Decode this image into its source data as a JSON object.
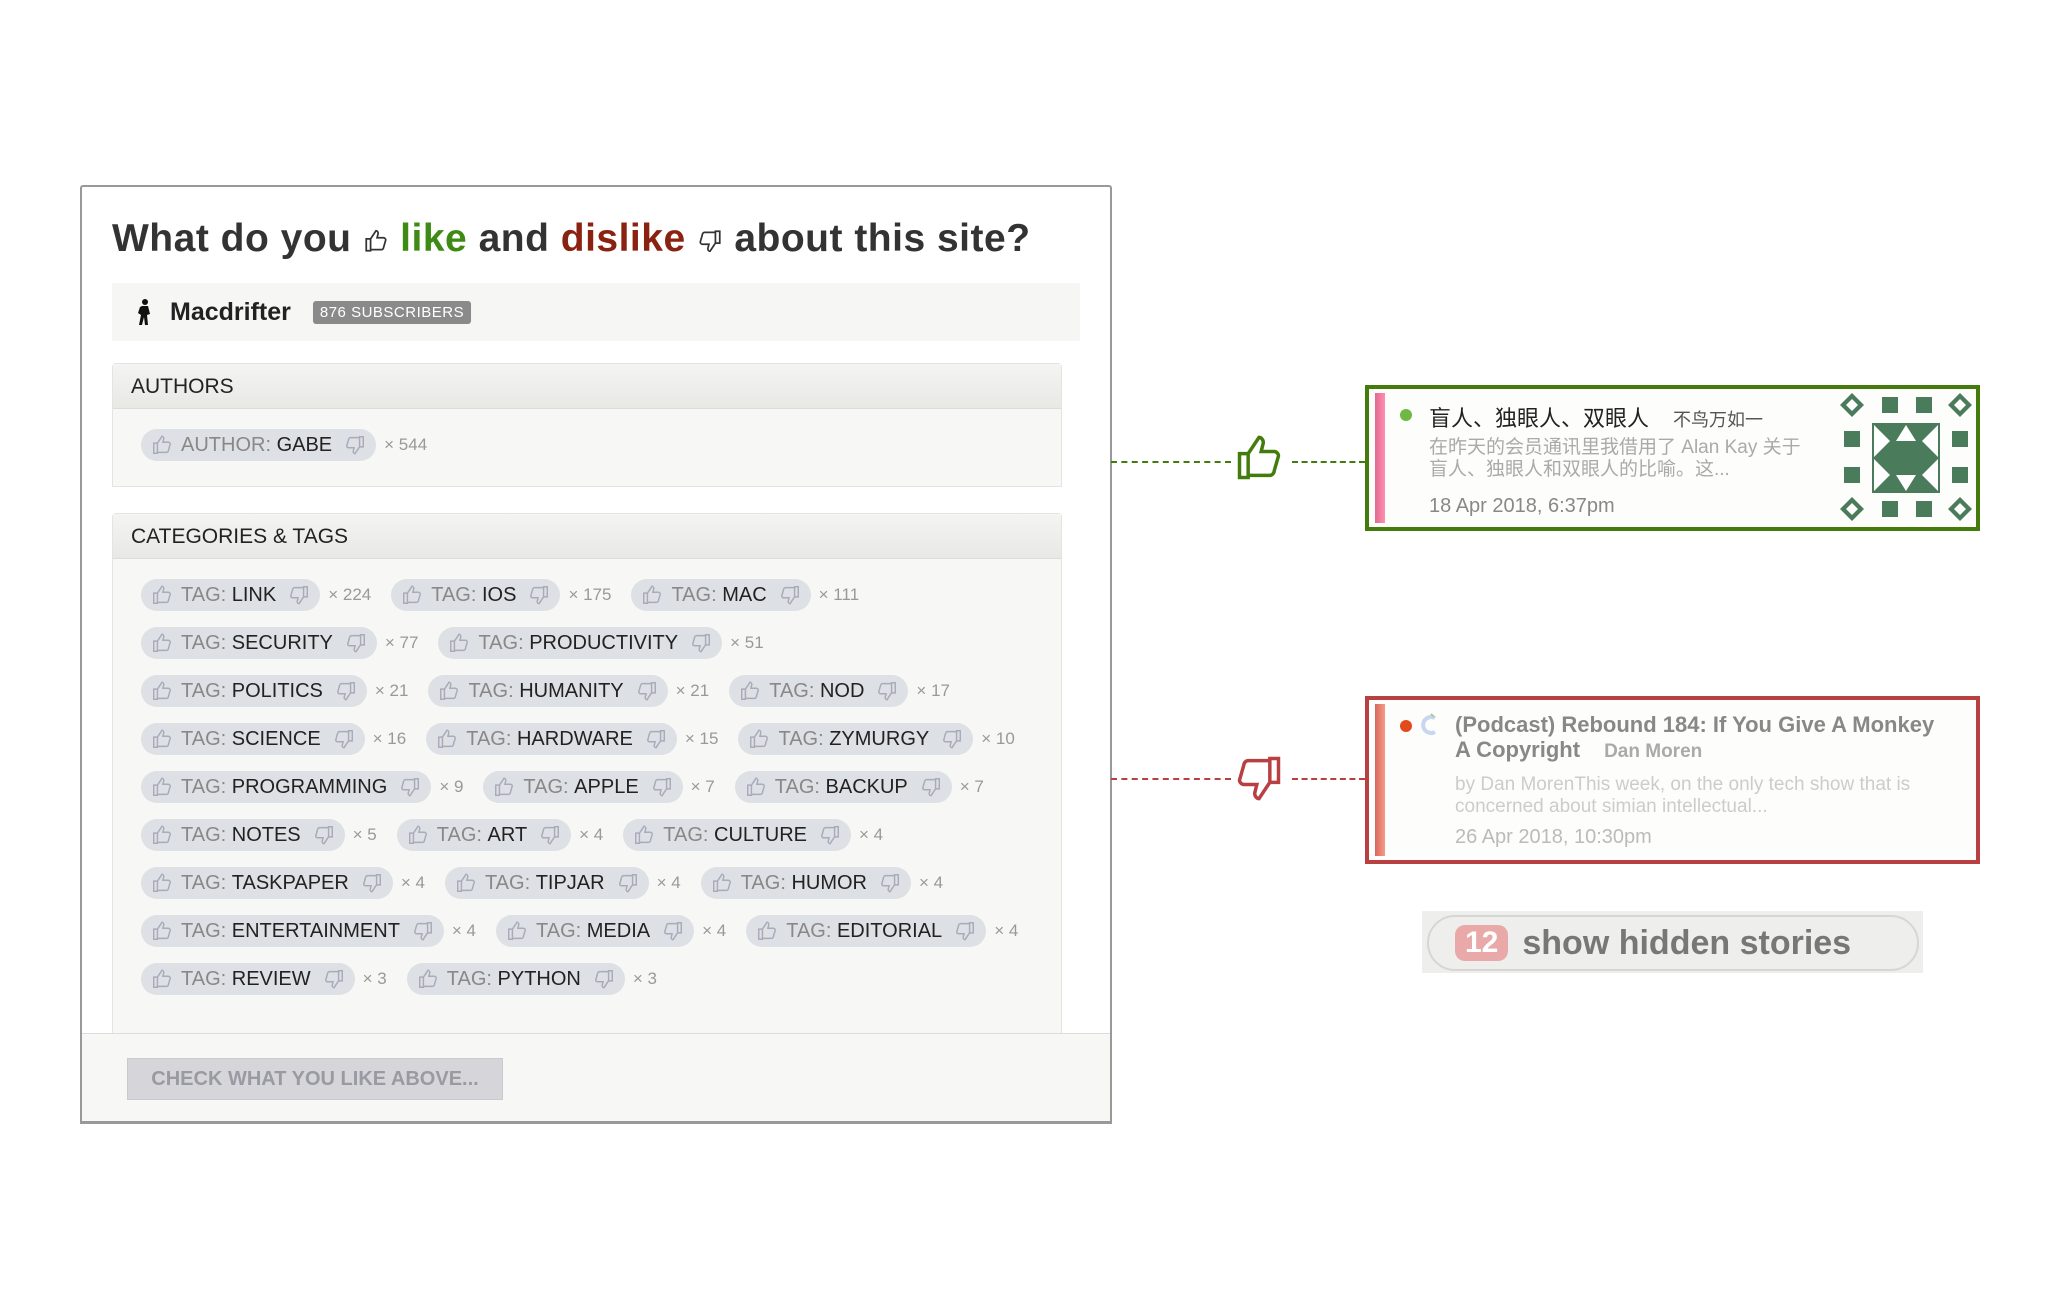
{
  "dialog": {
    "title": {
      "part1": "What do you",
      "like": "like",
      "part2": "and",
      "dislike": "dislike",
      "part3": "about this site?"
    },
    "feed": {
      "name": "Macdrifter",
      "subscribers": "876 SUBSCRIBERS"
    },
    "authors": {
      "header": "AUTHORS",
      "items": [
        {
          "prefix": "AUTHOR:",
          "name": "GABE",
          "count": "× 544"
        }
      ]
    },
    "categories": {
      "header": "CATEGORIES & TAGS",
      "items": [
        {
          "prefix": "TAG:",
          "name": "LINK",
          "count": "× 224"
        },
        {
          "prefix": "TAG:",
          "name": "IOS",
          "count": "× 175"
        },
        {
          "prefix": "TAG:",
          "name": "MAC",
          "count": "× 111"
        },
        {
          "prefix": "TAG:",
          "name": "SECURITY",
          "count": "× 77"
        },
        {
          "prefix": "TAG:",
          "name": "PRODUCTIVITY",
          "count": "× 51"
        },
        {
          "prefix": "TAG:",
          "name": "POLITICS",
          "count": "× 21"
        },
        {
          "prefix": "TAG:",
          "name": "HUMANITY",
          "count": "× 21"
        },
        {
          "prefix": "TAG:",
          "name": "NOD",
          "count": "× 17"
        },
        {
          "prefix": "TAG:",
          "name": "SCIENCE",
          "count": "× 16"
        },
        {
          "prefix": "TAG:",
          "name": "HARDWARE",
          "count": "× 15"
        },
        {
          "prefix": "TAG:",
          "name": "ZYMURGY",
          "count": "× 10"
        },
        {
          "prefix": "TAG:",
          "name": "PROGRAMMING",
          "count": "× 9"
        },
        {
          "prefix": "TAG:",
          "name": "APPLE",
          "count": "× 7"
        },
        {
          "prefix": "TAG:",
          "name": "BACKUP",
          "count": "× 7"
        },
        {
          "prefix": "TAG:",
          "name": "NOTES",
          "count": "× 5"
        },
        {
          "prefix": "TAG:",
          "name": "ART",
          "count": "× 4"
        },
        {
          "prefix": "TAG:",
          "name": "CULTURE",
          "count": "× 4"
        },
        {
          "prefix": "TAG:",
          "name": "TASKPAPER",
          "count": "× 4"
        },
        {
          "prefix": "TAG:",
          "name": "TIPJAR",
          "count": "× 4"
        },
        {
          "prefix": "TAG:",
          "name": "HUMOR",
          "count": "× 4"
        },
        {
          "prefix": "TAG:",
          "name": "ENTERTAINMENT",
          "count": "× 4"
        },
        {
          "prefix": "TAG:",
          "name": "MEDIA",
          "count": "× 4"
        },
        {
          "prefix": "TAG:",
          "name": "EDITORIAL",
          "count": "× 4"
        },
        {
          "prefix": "TAG:",
          "name": "REVIEW",
          "count": "× 3"
        },
        {
          "prefix": "TAG:",
          "name": "PYTHON",
          "count": "× 3"
        }
      ]
    },
    "submit_label": "CHECK WHAT YOU LIKE ABOVE..."
  },
  "liked_story": {
    "title": "盲人、独眼人、双眼人",
    "author": "不鸟万如一",
    "snippet": "在昨天的会员通讯里我借用了 Alan Kay 关于盲人、独眼人和双眼人的比喻。这...",
    "date": "18 Apr 2018, 6:37pm",
    "border_color": "#437c0c"
  },
  "disliked_story": {
    "title": "(Podcast) Rebound 184: If You Give A Monkey A Copyright",
    "author": "Dan Moren",
    "snippet": "by Dan MorenThis week, on the only tech show that is concerned about simian intellectual...",
    "date": "26 Apr 2018, 10:30pm",
    "border_color": "#b84043"
  },
  "hidden_stories": {
    "count": "12",
    "label": "show hidden stories"
  },
  "colors": {
    "like": "#3d8b12",
    "dislike": "#8a2211"
  }
}
